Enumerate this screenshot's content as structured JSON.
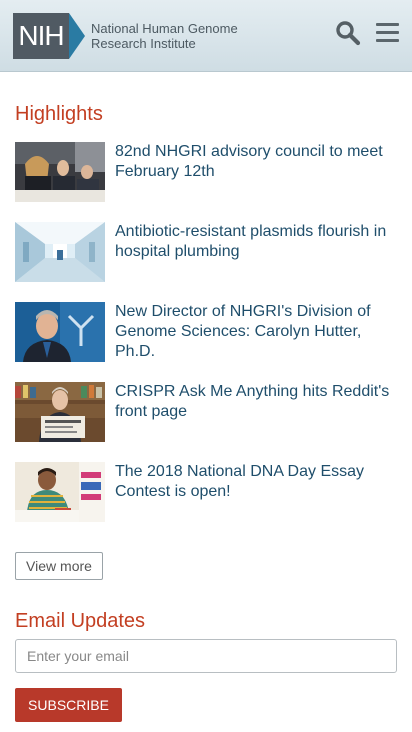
{
  "header": {
    "logo_abbr": "NIH",
    "logo_line1": "National Human Genome",
    "logo_line2": "Research Institute",
    "search_icon": "search-icon",
    "menu_icon": "hamburger-menu-icon"
  },
  "highlights": {
    "title": "Highlights",
    "items": [
      {
        "text": "82nd NHGRI advisory council to meet February 12th",
        "thumb": "council-meeting-photo"
      },
      {
        "text": "Antibiotic-resistant plasmids flourish in hospital plumbing",
        "thumb": "hospital-corridor-photo"
      },
      {
        "text": "New Director of NHGRI's Division of Genome Sciences: Carolyn Hutter, Ph.D.",
        "thumb": "director-portrait-photo"
      },
      {
        "text": "CRISPR Ask Me Anything hits Reddit's front page",
        "thumb": "crispr-ama-photo"
      },
      {
        "text": "The 2018 National DNA Day Essay Contest is open!",
        "thumb": "dna-day-student-photo"
      }
    ],
    "view_more": "View more"
  },
  "email": {
    "title": "Email Updates",
    "placeholder": "Enter your email",
    "subscribe": "SUBSCRIBE"
  },
  "colors": {
    "accent_title": "#c33f22",
    "link": "#1f4e6b",
    "button": "#b8392a",
    "header_bg": "#dbe6eb"
  }
}
